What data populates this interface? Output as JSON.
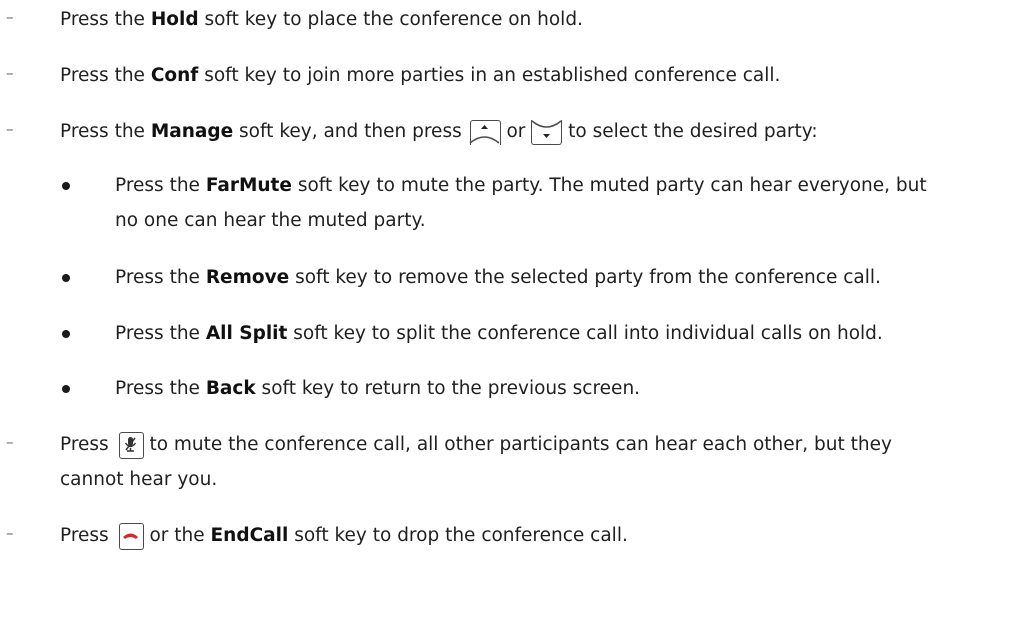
{
  "items": [
    {
      "pre": "Press the ",
      "key": "Hold",
      "post": " soft key to place the conference on hold."
    },
    {
      "pre": "Press the ",
      "key": "Conf",
      "post": " soft key to join more parties in an established conference call."
    },
    {
      "pre": "Press the ",
      "key": "Manage",
      "mid": " soft key, and then press ",
      "or": " or ",
      "post": " to select the desired party:"
    }
  ],
  "sub": [
    {
      "pre": "Press the ",
      "key": "FarMute",
      "post": " soft key to mute the party. The muted party can hear everyone, but",
      "cont": "no one can hear the muted party."
    },
    {
      "pre": "Press the ",
      "key": "Remove",
      "post": " soft key to remove the selected party from the conference call."
    },
    {
      "pre": "Press the ",
      "key": "All Split",
      "post": " soft key to split the conference call into individual calls on hold."
    },
    {
      "pre": "Press the ",
      "key": "Back",
      "post": " soft key to return to the previous screen."
    }
  ],
  "mute_item": {
    "pre": "Press ",
    "post": " to mute the conference call, all other participants can hear each other, but they",
    "cont": "cannot hear you."
  },
  "end_item": {
    "pre": "Press ",
    "mid": " or the ",
    "key": "EndCall",
    "post": " soft key to drop the conference call."
  },
  "dash": "–",
  "icons": [
    "up-arrow-key-icon",
    "down-arrow-key-icon",
    "mute-key-icon",
    "end-call-key-icon"
  ],
  "colors": {
    "end_call": "#d8262d"
  }
}
